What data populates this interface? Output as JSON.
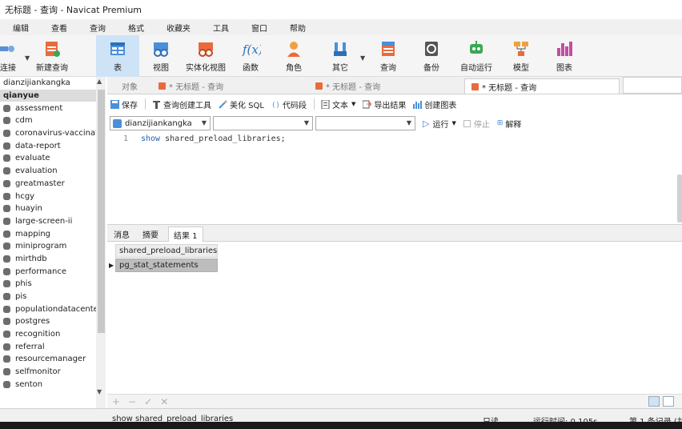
{
  "window": {
    "title": "无标题 - 查询 - Navicat Premium"
  },
  "menu": [
    "编辑",
    "查看",
    "查询",
    "格式",
    "收藏夹",
    "工具",
    "窗口",
    "帮助"
  ],
  "toolbar": {
    "connect": "连接",
    "new_query": "新建查询",
    "table": "表",
    "view": "视图",
    "materialized_view": "实体化视图",
    "function": "函数",
    "role": "角色",
    "other": "其它",
    "query": "查询",
    "backup": "备份",
    "auto_run": "自动运行",
    "model": "模型",
    "chart": "图表"
  },
  "sidebar": {
    "connection": "dianzijiankangka",
    "selected": "qianyue",
    "databases": [
      "assessment",
      "cdm",
      "coronavirus-vaccination",
      "data-report",
      "evaluate",
      "evaluation",
      "greatmaster",
      "hcgy",
      "huayin",
      "large-screen-ii",
      "mapping",
      "miniprogram",
      "mirthdb",
      "performance",
      "phis",
      "pis",
      "populationdatacenter",
      "postgres",
      "recognition",
      "referral",
      "resourcemanager",
      "selfmonitor",
      "senton"
    ]
  },
  "tabs": {
    "objects": "对象",
    "tab1": "* 无标题 - 查询",
    "tab2": "* 无标题 - 查询",
    "tab3": "* 无标题 - 查询"
  },
  "query_toolbar": {
    "save": "保存",
    "query_builder": "查询创建工具",
    "beautify": "美化 SQL",
    "code_snippet": "代码段",
    "text": "文本",
    "export": "导出结果",
    "create_chart": "创建图表"
  },
  "selectors": {
    "connection": "dianzijiankangka",
    "run": "运行",
    "stop": "停止",
    "explain": "解释"
  },
  "editor": {
    "line_number": "1",
    "code_keyword": "show",
    "code_rest": " shared_preload_libraries;"
  },
  "result_tabs": [
    "消息",
    "摘要",
    "结果 1"
  ],
  "result": {
    "column": "shared_preload_libraries",
    "row": "pg_stat_statements"
  },
  "grid_footer": {
    "add": "+",
    "remove": "−",
    "apply": "✓",
    "cancel": "✕"
  },
  "status": {
    "sql": "show shared_preload_libraries",
    "readonly": "只读",
    "runtime": "运行时间: 0.105s",
    "record": "第 1 条记录 (共"
  }
}
